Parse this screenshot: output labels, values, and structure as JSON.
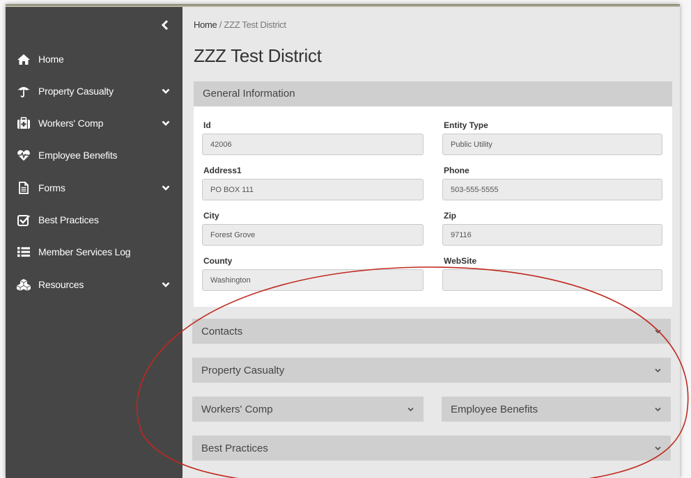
{
  "sidebar": {
    "items": [
      {
        "label": "Home",
        "icon": "home-icon",
        "has_submenu": false
      },
      {
        "label": "Property Casualty",
        "icon": "umbrella-icon",
        "has_submenu": true
      },
      {
        "label": "Workers' Comp",
        "icon": "medkit-icon",
        "has_submenu": true
      },
      {
        "label": "Employee Benefits",
        "icon": "heartbeat-icon",
        "has_submenu": false
      },
      {
        "label": "Forms",
        "icon": "file-icon",
        "has_submenu": true
      },
      {
        "label": "Best Practices",
        "icon": "check-square-icon",
        "has_submenu": false
      },
      {
        "label": "Member Services Log",
        "icon": "list-icon",
        "has_submenu": false
      },
      {
        "label": "Resources",
        "icon": "cubes-icon",
        "has_submenu": true
      }
    ]
  },
  "breadcrumb": {
    "home": "Home",
    "separator": " / ",
    "current": "ZZZ Test District"
  },
  "page_title": "ZZZ Test District",
  "general_info": {
    "header": "General Information",
    "fields": [
      {
        "label": "Id",
        "value": "42006"
      },
      {
        "label": "Entity Type",
        "value": "Public Utility"
      },
      {
        "label": "Address1",
        "value": "PO BOX 111"
      },
      {
        "label": "Phone",
        "value": "503-555-5555"
      },
      {
        "label": "City",
        "value": "Forest Grove"
      },
      {
        "label": "Zip",
        "value": "97116"
      },
      {
        "label": "County",
        "value": "Washington"
      },
      {
        "label": "WebSite",
        "value": ""
      }
    ]
  },
  "sections": {
    "contacts": "Contacts",
    "property_casualty": "Property Casualty",
    "workers_comp": "Workers' Comp",
    "employee_benefits": "Employee Benefits",
    "best_practices": "Best Practices"
  },
  "colors": {
    "sidebar_bg": "#464646",
    "panel_header_bg": "#cfcfcf",
    "content_bg": "#e8e8e8",
    "annotation_oval": "#c0281e"
  }
}
